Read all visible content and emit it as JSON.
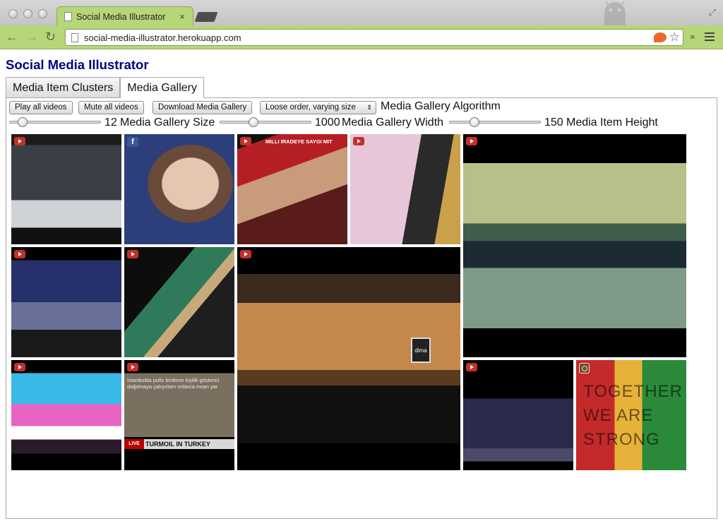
{
  "browser": {
    "tab_title": "Social Media Illustrator",
    "tab_close": "×",
    "url": "social-media-illustrator.herokuapp.com",
    "back_icon": "←",
    "forward_icon": "→",
    "reload_icon": "↻",
    "star_icon": "☆",
    "overflow_icon": "»",
    "expand_icon": "⤢"
  },
  "page": {
    "title": "Social Media Illustrator",
    "tabs": [
      {
        "label": "Media Item Clusters",
        "active": false
      },
      {
        "label": "Media Gallery",
        "active": true
      }
    ]
  },
  "controls": {
    "play_all": "Play all videos",
    "mute_all": "Mute all videos",
    "download": "Download Media Gallery",
    "algorithm_select": "Loose order, varying size",
    "algorithm_arrow": "⇕",
    "algorithm_label": "Media Gallery Algorithm",
    "size_value": "12",
    "size_label": "Media Gallery Size",
    "size_level": 0.1,
    "width_value": "1000",
    "width_label": "Media Gallery Width",
    "width_level": 0.35,
    "height_value": "150",
    "height_label": "Media Item Height",
    "height_level": 0.25
  },
  "gallery": {
    "items": [
      {
        "source": "youtube"
      },
      {
        "source": "facebook",
        "badge": "f"
      },
      {
        "source": "youtube",
        "caption": "MILLI IRADEYE SAYGI MIT"
      },
      {
        "source": "youtube"
      },
      {
        "source": "youtube"
      },
      {
        "source": "youtube"
      },
      {
        "source": "youtube"
      },
      {
        "source": "youtube",
        "sign": "dima"
      },
      {
        "source": "youtube"
      },
      {
        "source": "youtube",
        "caption": "İstanbulda polis binlerce kişilik gösterici dağıtmaya çalışırken onlarca insan yar",
        "live": "LIVE",
        "headline": "TURMOIL IN TURKEY"
      },
      {
        "source": "youtube"
      },
      {
        "source": "instagram",
        "text": "TOGETHER WE ARE STRONG"
      }
    ]
  },
  "colors": {
    "brand_title": "#00007f",
    "chrome_green": "#b6d67a",
    "youtube_red": "#c4302b",
    "facebook_blue": "#3b5998"
  }
}
